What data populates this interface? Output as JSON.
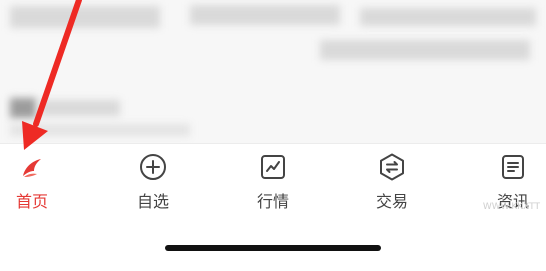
{
  "tabbar": {
    "items": [
      {
        "label": "首页",
        "icon": "home-logo-icon",
        "active": true
      },
      {
        "label": "自选",
        "icon": "plus-circle-icon",
        "active": false
      },
      {
        "label": "行情",
        "icon": "chart-line-icon",
        "active": false
      },
      {
        "label": "交易",
        "icon": "exchange-hexagon-icon",
        "active": false
      },
      {
        "label": "资讯",
        "icon": "news-document-icon",
        "active": false
      }
    ]
  },
  "watermark": "WWW.KKXTT",
  "colors": {
    "active": "#e53935",
    "inactive": "#444444",
    "arrow": "#ee2a24",
    "indicator": "#111111"
  }
}
